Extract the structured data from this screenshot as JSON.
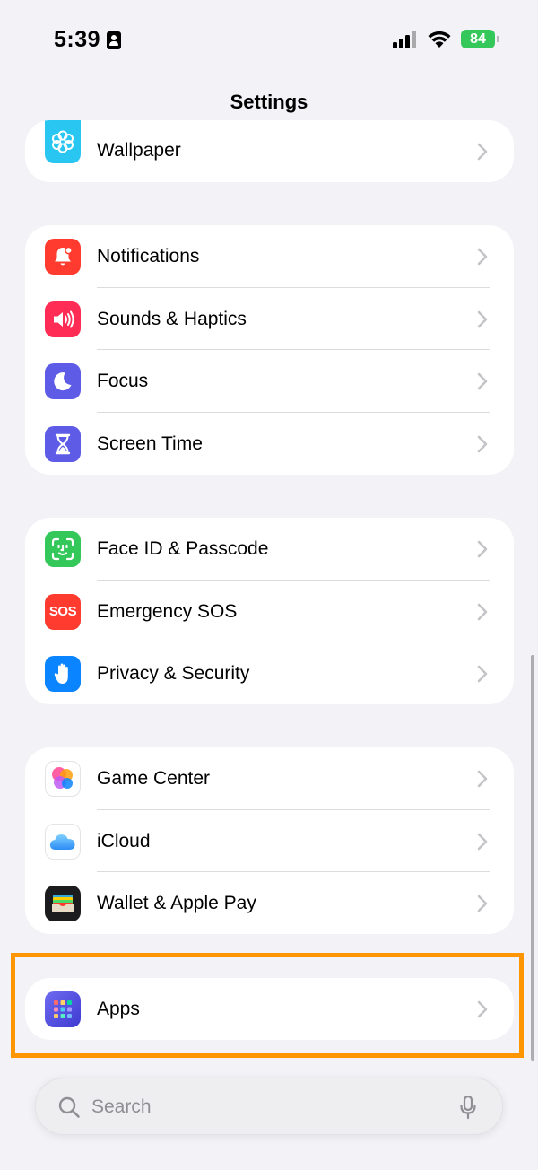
{
  "status_bar": {
    "time": "5:39",
    "battery": "84",
    "battery_color": "#34c759"
  },
  "nav": {
    "title": "Settings"
  },
  "groups": [
    {
      "rows": [
        {
          "label": "Wallpaper",
          "icon": "wallpaper-icon",
          "color": "#2ac6f2"
        }
      ]
    },
    {
      "rows": [
        {
          "label": "Notifications",
          "icon": "notifications-icon",
          "color": "#ff3b30"
        },
        {
          "label": "Sounds & Haptics",
          "icon": "sounds-icon",
          "color": "#ff2d55"
        },
        {
          "label": "Focus",
          "icon": "focus-icon",
          "color": "#5e5ce6"
        },
        {
          "label": "Screen Time",
          "icon": "screen-time-icon",
          "color": "#5e5ce6"
        }
      ]
    },
    {
      "rows": [
        {
          "label": "Face ID & Passcode",
          "icon": "face-id-icon",
          "color": "#34c759"
        },
        {
          "label": "Emergency SOS",
          "icon": "sos-icon",
          "color": "#ff3b30",
          "icon_text": "SOS"
        },
        {
          "label": "Privacy & Security",
          "icon": "privacy-hand-icon",
          "color": "#0a84ff"
        }
      ]
    },
    {
      "rows": [
        {
          "label": "Game Center",
          "icon": "game-center-icon",
          "color": "#ffffff"
        },
        {
          "label": "iCloud",
          "icon": "icloud-icon",
          "color": "#ffffff"
        },
        {
          "label": "Wallet & Apple Pay",
          "icon": "wallet-icon",
          "color": "#1c1c1e"
        }
      ]
    },
    {
      "rows": [
        {
          "label": "Apps",
          "icon": "apps-grid-icon",
          "color": "#5e5ce6"
        }
      ]
    }
  ],
  "search": {
    "placeholder": "Search"
  },
  "highlight_color": "#ff9500"
}
